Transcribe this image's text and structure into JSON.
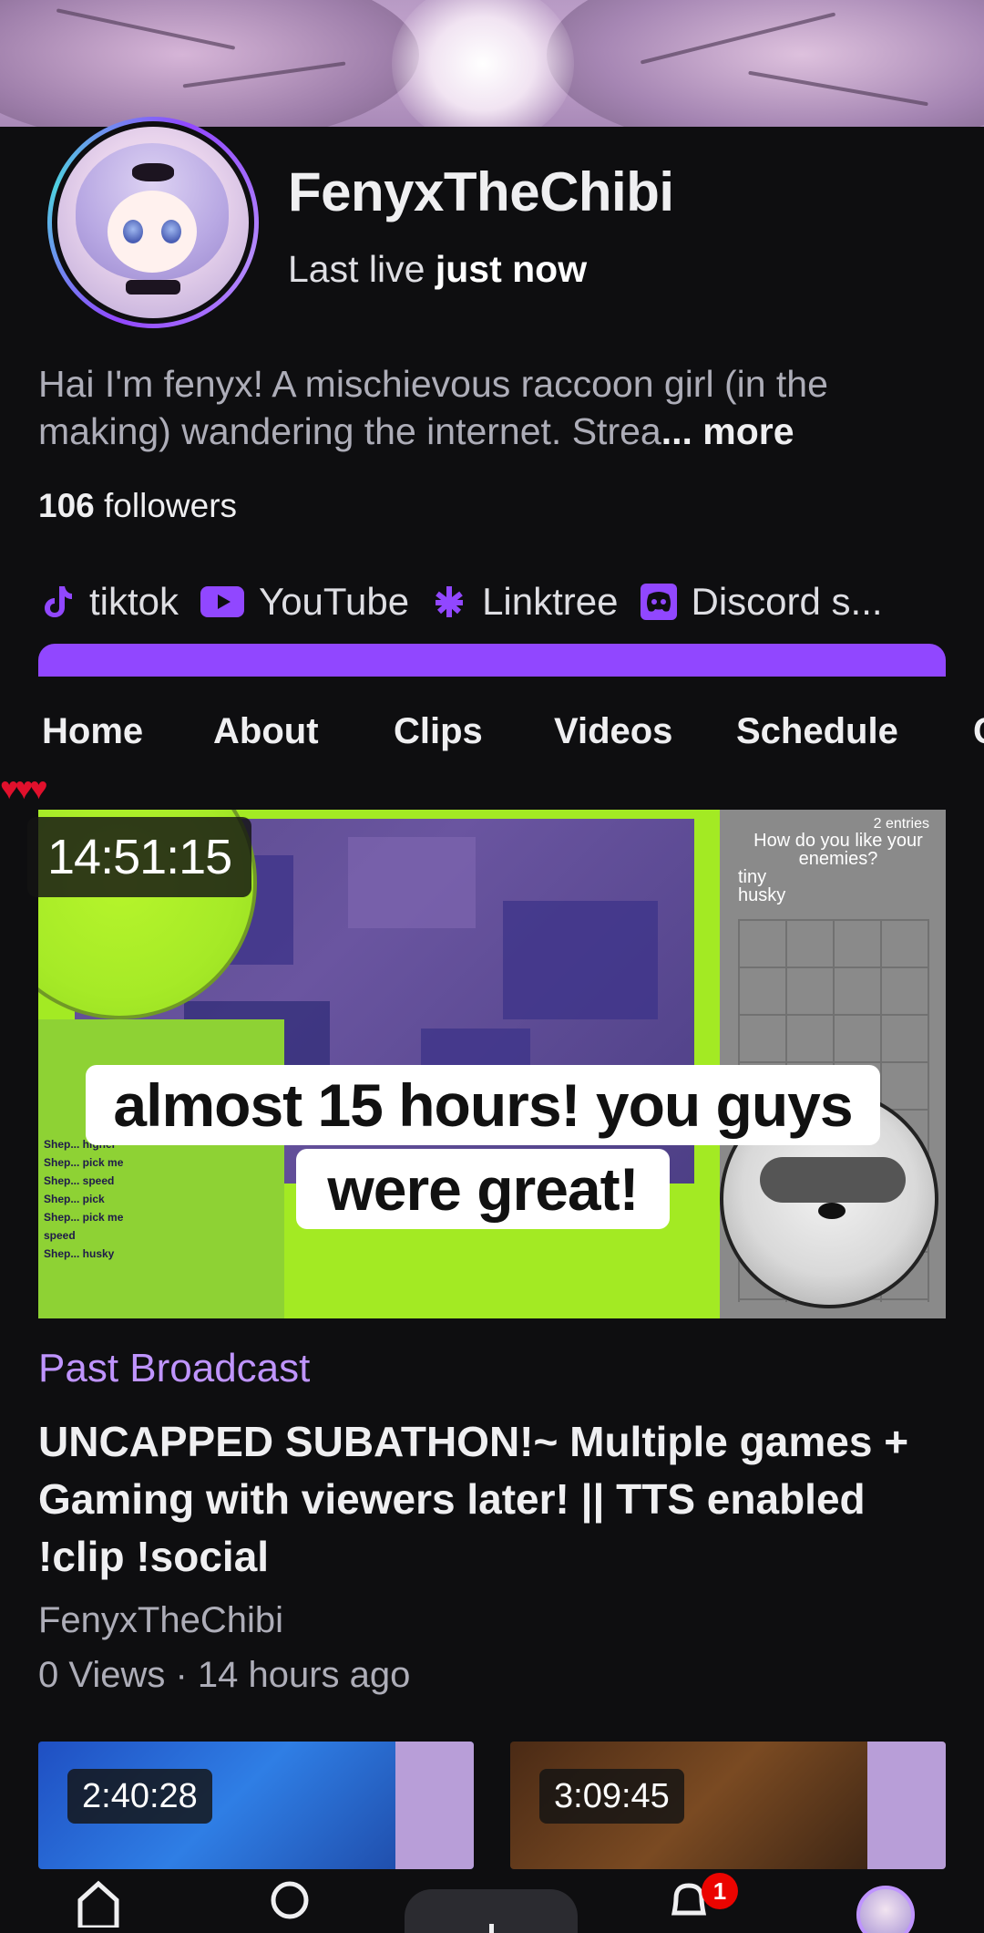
{
  "channel": {
    "name": "FenyxTheChibi",
    "last_live_prefix": "Last live",
    "last_live_value": "just now",
    "bio": "Hai I'm fenyx! A mischievous raccoon girl (in the making) wandering the internet. Strea",
    "bio_more": "... more",
    "followers_count": "106",
    "followers_label": "followers"
  },
  "socials": [
    {
      "label": "tiktok",
      "icon": "tiktok-icon"
    },
    {
      "label": "YouTube",
      "icon": "youtube-icon"
    },
    {
      "label": "Linktree",
      "icon": "linktree-icon"
    },
    {
      "label": "Discord s...",
      "icon": "discord-icon"
    }
  ],
  "tabs": [
    {
      "label": "Home",
      "active": true
    },
    {
      "label": "About",
      "active": false
    },
    {
      "label": "Clips",
      "active": false
    },
    {
      "label": "Videos",
      "active": false
    },
    {
      "label": "Schedule",
      "active": false
    },
    {
      "label": "C",
      "active": false
    }
  ],
  "featured_video": {
    "timer_overlay": "14:51:15",
    "caption_line1": "almost 15 hours! you guys",
    "caption_line2": "were great!",
    "game_question": "How do you like your enemies?",
    "game_entries": "2 entries",
    "game_options": [
      "tiny",
      "husky"
    ],
    "chat_lines": [
      "Shep... higher",
      "Shep... pick me",
      "Shep... speed",
      "Shep... pick",
      "Shep... pick me",
      "speed",
      "Shep... husky"
    ],
    "type_label": "Past Broadcast",
    "title": "UNCAPPED SUBATHON!~ Multiple games + Gaming with viewers later! || TTS enabled !clip !social",
    "channel": "FenyxTheChibi",
    "meta": "0 Views · 14 hours ago"
  },
  "more_videos": [
    {
      "duration": "2:40:28"
    },
    {
      "duration": "3:09:45"
    }
  ],
  "bottom_nav": {
    "notifications_badge": "1"
  },
  "colors": {
    "accent": "#9147ff",
    "accent_light": "#bf94ff",
    "background": "#0e0e10",
    "badge": "#eb0400"
  }
}
